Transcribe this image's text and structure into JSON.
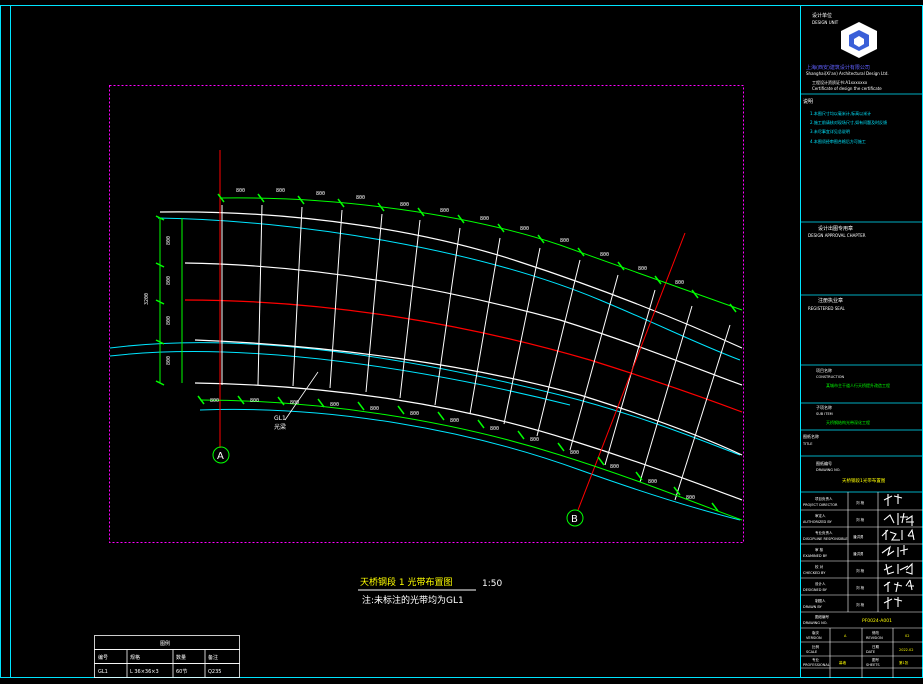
{
  "colors": {
    "background": "#000000",
    "border": "#00e5ff",
    "magenta": "#ff00ff",
    "beam_green": "#00ff00",
    "beam_white": "#ffffff",
    "axis_red": "#ff0000",
    "edge_cyan": "#00e5ff",
    "label_yellow": "#ffff00",
    "title_blue": "#6060ff"
  },
  "drawing": {
    "grid_a": "A",
    "grid_b": "B",
    "label_gl1": "GL1",
    "label_beam": "光梁",
    "title": "天桥钢段  1 光带布置图",
    "scale": "1:50",
    "note": "注:未标注的光带均为GL1"
  },
  "legend_table": {
    "title": "图例",
    "headers": [
      "编号",
      "规格",
      "数量",
      "备注"
    ],
    "row": [
      "GL1",
      "L 36×36×3",
      "60节",
      "Q235"
    ]
  },
  "title_block": {
    "design_unit_cn": "设计单位",
    "design_unit_en": "DESIGN UNIT",
    "company_cn": "上海(西安)建筑设计有限公司",
    "company_en": "Shanghai(Xi'an) Architectural Design Ltd.",
    "cert_no": "工程设计资质证书:A1xxxxxxx",
    "cert_en": "Certificate of design the certificate",
    "notes_header": "说明",
    "notes": [
      "1.本图尺寸均以毫米计,标高以米计",
      "2.施工前请核对现场尺寸,如有问题及时反馈",
      "3.未尽事宜详见总说明",
      "4.本图须经审图合格后方可施工"
    ],
    "approval_cn": "设计出图专用章",
    "approval_en": "DESIGN APPROVAL CHAPTER",
    "registered_cn": "注册执业章",
    "registered_en": "REGISTERED SEAL",
    "project_label_cn": "项目名称",
    "project_label_en": "CONSTRUCTION",
    "project_value": "某城市主干道人行天桥提升改造工程",
    "sub_label_cn": "子项名称",
    "sub_label_en": "SUB ITEM",
    "sub_value": "天桥钢结构光带深化工程",
    "sheet_label_cn": "图纸名称",
    "sheet_label_en": "TITLE",
    "sheet_value": "天桥钢段1光带布置图",
    "drawing_no_label_cn": "图纸编号",
    "drawing_no_label_en": "DRAWING NO.",
    "sign_rows": [
      {
        "cn": "项目负责人",
        "en": "PROJECT DIRECTOR",
        "name": "刘 杨"
      },
      {
        "cn": "审定人",
        "en": "AUTHORIZED BY",
        "name": "刘 杨"
      },
      {
        "cn": "专业负责人",
        "en": "DISCIPLINE RESPONSIBLE",
        "name": "潘洪勇"
      },
      {
        "cn": "审 核",
        "en": "EXAMINED BY",
        "name": "潘洪勇"
      },
      {
        "cn": "校 对",
        "en": "CHECKED BY",
        "name": "刘 杨"
      },
      {
        "cn": "设计人",
        "en": "DESIGNED BY",
        "name": "刘 杨"
      },
      {
        "cn": "制图人",
        "en": "DRAWN BY",
        "name": "刘 杨"
      }
    ],
    "drawing_no_value": "PF0024-A001",
    "version_label_cn": "版次",
    "version_label_en": "VERSION",
    "version_value": "A",
    "revision_label_cn": "修改",
    "revision_label_en": "REVISION",
    "revision_value": "02",
    "scale_label_cn": "比例",
    "scale_label_en": "SCALE",
    "date_label_cn": "日期",
    "date_label_en": "DATE",
    "date_value": "2022.02",
    "discipline_label_cn": "专业",
    "discipline_label_en": "PROFESSIONAL",
    "discipline_value": "幕墙",
    "sheet_count_label_cn": "图号",
    "sheet_count_label_en": "SHEETS",
    "sheet_count_value": "第1张"
  }
}
